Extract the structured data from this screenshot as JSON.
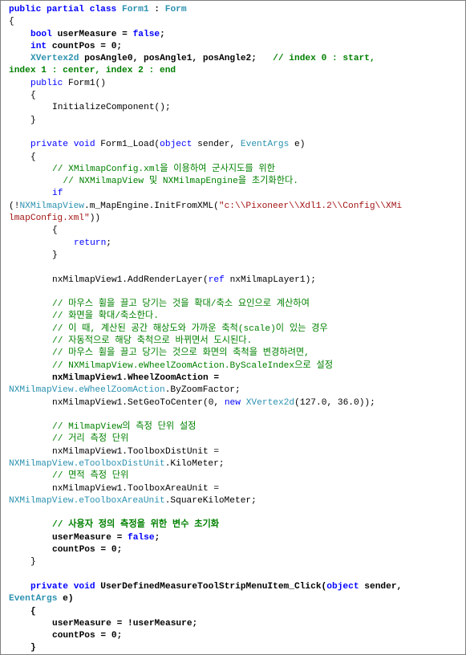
{
  "document": {
    "language": "C#",
    "colors": {
      "keyword": "#0000ff",
      "type": "#2b91af",
      "comment": "#008000",
      "string": "#a31515",
      "plain": "#000000"
    },
    "lines": [
      {
        "indent": 0,
        "bold": true,
        "tokens": [
          [
            "kw",
            "public partial class "
          ],
          [
            "ty",
            "Form1"
          ],
          [
            "pl",
            " : "
          ],
          [
            "ty",
            "Form"
          ]
        ]
      },
      {
        "indent": 0,
        "tokens": [
          [
            "pl",
            "{"
          ]
        ]
      },
      {
        "indent": 1,
        "bold": true,
        "tokens": [
          [
            "kw",
            "bool"
          ],
          [
            "pl",
            " userMeasure = "
          ],
          [
            "kw",
            "false"
          ],
          [
            "pl",
            ";"
          ]
        ]
      },
      {
        "indent": 1,
        "bold": true,
        "tokens": [
          [
            "kw",
            "int"
          ],
          [
            "pl",
            " countPos = 0;"
          ]
        ]
      },
      {
        "indent": 1,
        "bold": true,
        "tokens": [
          [
            "ty",
            "XVertex2d"
          ],
          [
            "pl",
            " posAngle0, posAngle1, posAngle2;   "
          ],
          [
            "cm",
            "// index 0 : start,"
          ]
        ]
      },
      {
        "indent": 0,
        "bold": true,
        "tokens": [
          [
            "cm",
            "index 1 : center, index 2 : end"
          ]
        ]
      },
      {
        "indent": 1,
        "tokens": [
          [
            "kw",
            "public"
          ],
          [
            "pl",
            " Form1()"
          ]
        ]
      },
      {
        "indent": 1,
        "tokens": [
          [
            "pl",
            "{"
          ]
        ]
      },
      {
        "indent": 2,
        "tokens": [
          [
            "pl",
            "InitializeComponent();"
          ]
        ]
      },
      {
        "indent": 1,
        "tokens": [
          [
            "pl",
            "}"
          ]
        ]
      },
      {
        "indent": 0,
        "tokens": [
          [
            "pl",
            ""
          ]
        ]
      },
      {
        "indent": 1,
        "tokens": [
          [
            "kw",
            "private void"
          ],
          [
            "pl",
            " Form1_Load("
          ],
          [
            "kw",
            "object"
          ],
          [
            "pl",
            " sender, "
          ],
          [
            "ty",
            "EventArgs"
          ],
          [
            "pl",
            " e)"
          ]
        ]
      },
      {
        "indent": 1,
        "tokens": [
          [
            "pl",
            "{"
          ]
        ]
      },
      {
        "indent": 2,
        "tokens": [
          [
            "cm",
            "// XMilmapConfig.xml을 이용하여 군사지도를 위한"
          ]
        ]
      },
      {
        "indent": 2,
        "tokens": [
          [
            "cm",
            "  // NXMilmapView 및 NXMilmapEngine을 초기화한다."
          ]
        ]
      },
      {
        "indent": 2,
        "tokens": [
          [
            "kw",
            "if"
          ]
        ]
      },
      {
        "indent": 0,
        "tokens": [
          [
            "pl",
            "(!"
          ],
          [
            "ty",
            "NXMilmapView"
          ],
          [
            "pl",
            ".m_MapEngine.InitFromXML("
          ],
          [
            "st",
            "\"c:\\\\Pixoneer\\\\Xdl1.2\\\\Config\\\\XMi"
          ]
        ]
      },
      {
        "indent": 0,
        "tokens": [
          [
            "st",
            "lmapConfig.xml\""
          ],
          [
            "pl",
            "))"
          ]
        ]
      },
      {
        "indent": 2,
        "tokens": [
          [
            "pl",
            "{"
          ]
        ]
      },
      {
        "indent": 3,
        "tokens": [
          [
            "kw",
            "return"
          ],
          [
            "pl",
            ";"
          ]
        ]
      },
      {
        "indent": 2,
        "tokens": [
          [
            "pl",
            "}"
          ]
        ]
      },
      {
        "indent": 0,
        "tokens": [
          [
            "pl",
            ""
          ]
        ]
      },
      {
        "indent": 2,
        "tokens": [
          [
            "pl",
            "nxMilmapView1.AddRenderLayer("
          ],
          [
            "kw",
            "ref"
          ],
          [
            "pl",
            " nxMilmapLayer1);"
          ]
        ]
      },
      {
        "indent": 0,
        "tokens": [
          [
            "pl",
            ""
          ]
        ]
      },
      {
        "indent": 2,
        "tokens": [
          [
            "cm",
            "// 마우스 휠을 끌고 당기는 것을 확대/축소 요인으로 계산하여"
          ]
        ]
      },
      {
        "indent": 2,
        "tokens": [
          [
            "cm",
            "// 화면을 확대/축소한다."
          ]
        ]
      },
      {
        "indent": 2,
        "tokens": [
          [
            "cm",
            "// 이 때, 계산된 공간 해상도와 가까운 축척(scale)이 있는 경우"
          ]
        ]
      },
      {
        "indent": 2,
        "tokens": [
          [
            "cm",
            "// 자동적으로 해당 축척으로 바뀌면서 도시된다."
          ]
        ]
      },
      {
        "indent": 2,
        "tokens": [
          [
            "cm",
            "// 마우스 휠을 끌고 당기는 것으로 화면의 축척을 변경하려면,"
          ]
        ]
      },
      {
        "indent": 2,
        "tokens": [
          [
            "cm",
            "// NXMilmapView.eWheelZoomAction.ByScaleIndex으로 설정"
          ]
        ]
      },
      {
        "indent": 2,
        "bold": true,
        "tokens": [
          [
            "pl",
            "nxMilmapView1.WheelZoomAction ="
          ]
        ]
      },
      {
        "indent": 0,
        "tokens": [
          [
            "ty",
            "NXMilmapView.eWheelZoomAction"
          ],
          [
            "pl",
            ".ByZoomFactor;"
          ]
        ]
      },
      {
        "indent": 2,
        "tokens": [
          [
            "pl",
            "nxMilmapView1.SetGeoToCenter(0, "
          ],
          [
            "kw",
            "new"
          ],
          [
            "pl",
            " "
          ],
          [
            "ty",
            "XVertex2d"
          ],
          [
            "pl",
            "(127.0, 36.0));"
          ]
        ]
      },
      {
        "indent": 0,
        "tokens": [
          [
            "pl",
            ""
          ]
        ]
      },
      {
        "indent": 2,
        "tokens": [
          [
            "cm",
            "// MilmapView의 측정 단위 설정"
          ]
        ]
      },
      {
        "indent": 2,
        "tokens": [
          [
            "cm",
            "// 거리 측정 단위"
          ]
        ]
      },
      {
        "indent": 2,
        "tokens": [
          [
            "pl",
            "nxMilmapView1.ToolboxDistUnit ="
          ]
        ]
      },
      {
        "indent": 0,
        "tokens": [
          [
            "ty",
            "NXMilmapView.eToolboxDistUnit"
          ],
          [
            "pl",
            ".KiloMeter;"
          ]
        ]
      },
      {
        "indent": 2,
        "tokens": [
          [
            "cm",
            "// 면적 측정 단위"
          ]
        ]
      },
      {
        "indent": 2,
        "tokens": [
          [
            "pl",
            "nxMilmapView1.ToolboxAreaUnit ="
          ]
        ]
      },
      {
        "indent": 0,
        "tokens": [
          [
            "ty",
            "NXMilmapView.eToolboxAreaUnit"
          ],
          [
            "pl",
            ".SquareKiloMeter;"
          ]
        ]
      },
      {
        "indent": 0,
        "tokens": [
          [
            "pl",
            ""
          ]
        ]
      },
      {
        "indent": 2,
        "bold": true,
        "tokens": [
          [
            "cm",
            "// 사용자 정의 측정을 위한 변수 초기화"
          ]
        ]
      },
      {
        "indent": 2,
        "bold": true,
        "tokens": [
          [
            "pl",
            "userMeasure = "
          ],
          [
            "kw",
            "false"
          ],
          [
            "pl",
            ";"
          ]
        ]
      },
      {
        "indent": 2,
        "bold": true,
        "tokens": [
          [
            "pl",
            "countPos = 0;"
          ]
        ]
      },
      {
        "indent": 1,
        "tokens": [
          [
            "pl",
            "}"
          ]
        ]
      },
      {
        "indent": 0,
        "tokens": [
          [
            "pl",
            ""
          ]
        ]
      },
      {
        "indent": 1,
        "bold": true,
        "tokens": [
          [
            "kw",
            "private void"
          ],
          [
            "pl",
            " UserDefinedMeasureToolStripMenuItem_Click("
          ],
          [
            "kw",
            "object"
          ],
          [
            "pl",
            " sender,"
          ]
        ]
      },
      {
        "indent": 0,
        "bold": true,
        "tokens": [
          [
            "ty",
            "EventArgs"
          ],
          [
            "pl",
            " e)"
          ]
        ]
      },
      {
        "indent": 1,
        "bold": true,
        "tokens": [
          [
            "pl",
            "{"
          ]
        ]
      },
      {
        "indent": 2,
        "bold": true,
        "tokens": [
          [
            "pl",
            "userMeasure = !userMeasure;"
          ]
        ]
      },
      {
        "indent": 2,
        "bold": true,
        "tokens": [
          [
            "pl",
            "countPos = 0;"
          ]
        ]
      },
      {
        "indent": 1,
        "bold": true,
        "tokens": [
          [
            "pl",
            "}"
          ]
        ]
      }
    ]
  }
}
